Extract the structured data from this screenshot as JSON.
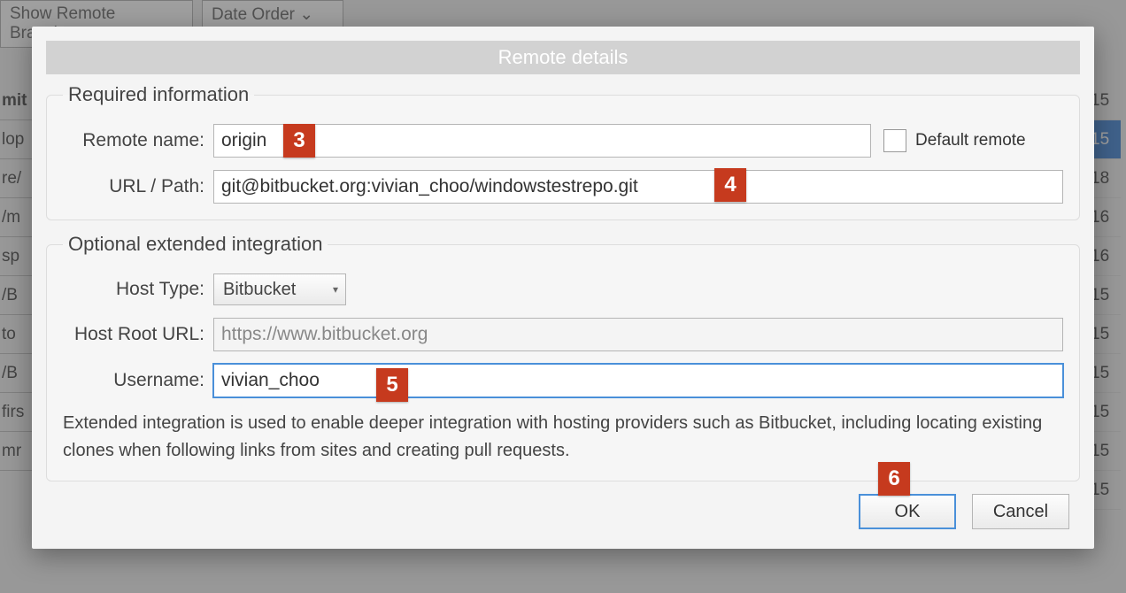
{
  "background": {
    "toolbar_button_1": "Show Remote Branches",
    "toolbar_button_2": "Date Order  ⌄",
    "left_cells": [
      "mit",
      "lop",
      "re/",
      "/m",
      "sp",
      "/B",
      "to",
      "/B",
      "firs",
      "mr"
    ],
    "right_cells": [
      "15",
      "15",
      "18",
      "16",
      "16",
      "15",
      "15",
      "15",
      "15",
      "15",
      "15"
    ]
  },
  "dialog": {
    "title": "Remote details",
    "required": {
      "legend": "Required information",
      "remote_name_label": "Remote name:",
      "remote_name_value": "origin",
      "default_remote_label": "Default remote",
      "url_label": "URL / Path:",
      "url_value": "git@bitbucket.org:vivian_choo/windowstestrepo.git"
    },
    "optional": {
      "legend": "Optional extended integration",
      "host_type_label": "Host Type:",
      "host_type_value": "Bitbucket",
      "host_root_label": "Host Root URL:",
      "host_root_value": "https://www.bitbucket.org",
      "username_label": "Username:",
      "username_value": "vivian_choo",
      "description": "Extended integration is used to enable deeper integration with hosting providers such as Bitbucket, including locating existing clones when following links from sites and creating pull requests."
    },
    "buttons": {
      "ok": "OK",
      "cancel": "Cancel"
    }
  },
  "callouts": {
    "c3": "3",
    "c4": "4",
    "c5": "5",
    "c6": "6"
  }
}
